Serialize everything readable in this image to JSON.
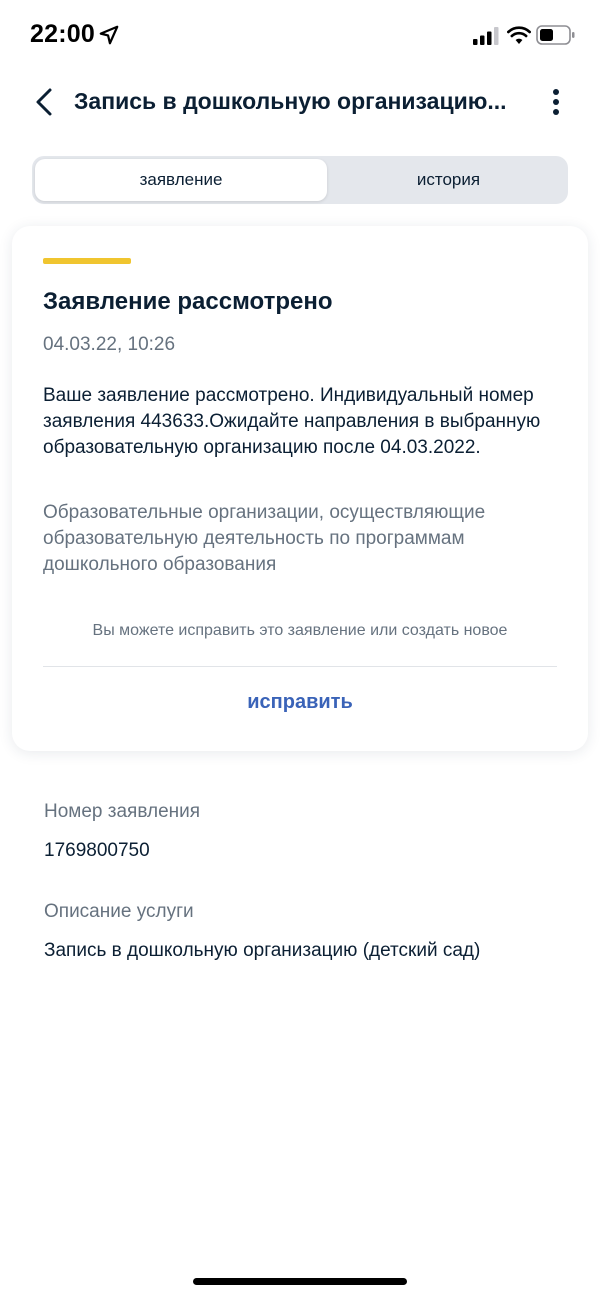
{
  "status_bar": {
    "time": "22:00",
    "icons": [
      "location-arrow-icon",
      "cellular-signal-icon",
      "wifi-icon",
      "battery-icon"
    ]
  },
  "header": {
    "title": "Запись в дошкольную организацию...",
    "back_icon": "chevron-left-icon",
    "menu_icon": "more-vertical-icon"
  },
  "tabs": [
    {
      "label": "заявление",
      "active": true
    },
    {
      "label": "история",
      "active": false
    }
  ],
  "status_card": {
    "accent_color": "#f0c52f",
    "title": "Заявление рассмотрено",
    "date": "04.03.22, 10:26",
    "text": "Ваше заявление рассмотрено. Индивидуальный номер заявления 443633.Ожидайте направления в выбранную образовательную организацию после 04.03.2022.",
    "note": "Образовательные организации, осуществляющие образовательную деятельность по программам дошкольного образования",
    "hint": "Вы можете исправить это заявление или создать новое",
    "edit_label": "исправить"
  },
  "details": {
    "application_number_label": "Номер заявления",
    "application_number": "1769800750",
    "service_description_label": "Описание услуги",
    "service_description": "Запись в дошкольную организацию (детский сад)"
  },
  "colors": {
    "link": "#3a63b8",
    "muted_text": "#66727f",
    "primary_text": "#0b1f33"
  }
}
